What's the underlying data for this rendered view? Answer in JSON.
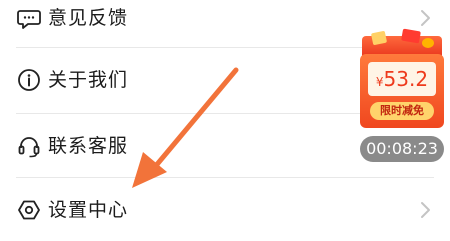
{
  "menu": {
    "items": [
      {
        "label": "意见反馈",
        "icon": "chat-bubble-icon",
        "has_chevron": true
      },
      {
        "label": "关于我们",
        "icon": "info-circle-icon",
        "has_chevron": false
      },
      {
        "label": "联系客服",
        "icon": "headset-icon",
        "has_chevron": false
      },
      {
        "label": "设置中心",
        "icon": "hexagon-settings-icon",
        "has_chevron": true
      }
    ]
  },
  "promo": {
    "currency": "¥",
    "price": "53.2",
    "tag": "限时减免",
    "timer": "00:08:23"
  },
  "colors": {
    "annotation_arrow": "#f2733a",
    "promo_red": "#ee3a1c",
    "timer_bg": "#8a8a8a"
  }
}
